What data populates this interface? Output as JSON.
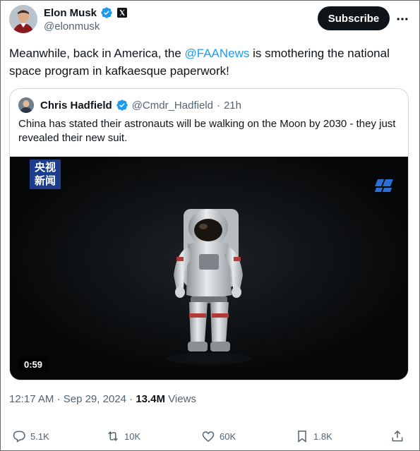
{
  "author": {
    "name": "Elon Musk",
    "handle": "@elonmusk"
  },
  "header": {
    "subscribe_label": "Subscribe"
  },
  "tweet": {
    "text_before": "Meanwhile, back in America, the ",
    "mention": "@FAANews",
    "text_after": " is smothering the national space program in kafkaesque paperwork!"
  },
  "quote": {
    "name": "Chris Hadfield",
    "handle": "@Cmdr_Hadfield",
    "dot": "·",
    "time": "21h",
    "text": "China has stated their astronauts will be walking on the Moon by 2030 - they just revealed their new suit.",
    "video": {
      "logo_line1": "央视",
      "logo_line2": "新闻",
      "duration": "0:59"
    }
  },
  "meta": {
    "time": "12:17 AM",
    "date": "Sep 29, 2024",
    "sep": "·",
    "views_count": "13.4M",
    "views_label": "Views"
  },
  "actions": {
    "replies": "5.1K",
    "reposts": "10K",
    "likes": "60K",
    "bookmarks": "1.8K"
  },
  "icons": [
    "verified-icon",
    "x-logo-icon",
    "more-icon",
    "reply-icon",
    "repost-icon",
    "like-icon",
    "bookmark-icon",
    "share-icon"
  ],
  "colors": {
    "accent": "#1d9bf0",
    "text": "#0f1419",
    "muted": "#536471",
    "border": "#cfd9de",
    "button_bg": "#0f1419"
  }
}
